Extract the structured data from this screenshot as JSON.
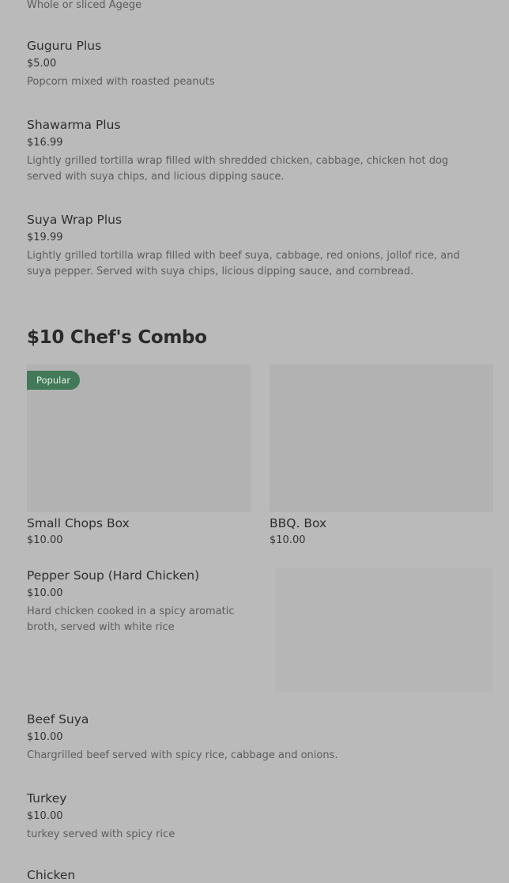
{
  "menu": {
    "top_partial_desc": "Whole or sliced Agege",
    "items_before": [
      {
        "name": "Guguru Plus",
        "price": "$5.00",
        "desc": "Popcorn mixed with roasted peanuts"
      },
      {
        "name": "Shawarma Plus",
        "price": "$16.99",
        "desc": "Lightly grilled tortilla wrap filled with shredded chicken, cabbage, chicken hot dog served with suya chips, and licious dipping sauce."
      },
      {
        "name": "Suya Wrap Plus",
        "price": "$19.99",
        "desc": "Lightly grilled tortilla wrap filled with beef suya, cabbage, red onions, jollof rice, and suya pepper. Served with suya chips, licious dipping sauce, and cornbread."
      }
    ],
    "section_title": "$10 Chef's Combo",
    "cards": [
      {
        "name": "Small Chops Box",
        "price": "$10.00",
        "badge": "Popular"
      },
      {
        "name": "BBQ. Box",
        "price": "$10.00"
      }
    ],
    "items_after": [
      {
        "name": "Pepper Soup (Hard Chicken)",
        "price": "$10.00",
        "desc": "Hard chicken cooked in a spicy aromatic broth, served with white rice"
      },
      {
        "name": "Beef Suya",
        "price": "$10.00",
        "desc": "Chargrilled beef served with spicy rice, cabbage and onions."
      },
      {
        "name": "Turkey",
        "price": "$10.00",
        "desc": "turkey served with spicy rice"
      }
    ],
    "bottom_partial_name": "Chicken"
  },
  "colors": {
    "background": "#bababa",
    "badge": "#427a59",
    "image_placeholder": "#b2b2b2"
  }
}
